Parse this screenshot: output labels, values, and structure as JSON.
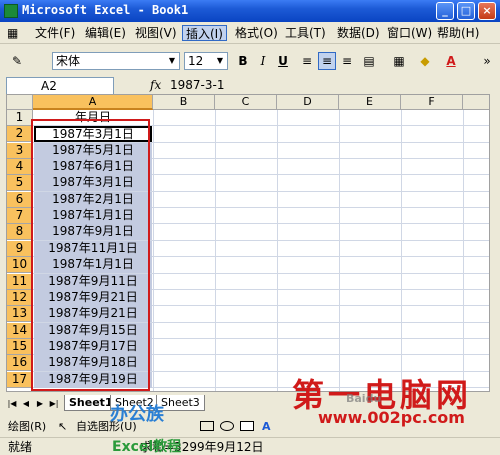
{
  "window": {
    "title": "Microsoft Excel - Book1",
    "minimize": "_",
    "maximize": "□",
    "close": "×"
  },
  "menubar": {
    "items": [
      "文件(F)",
      "编辑(E)",
      "视图(V)",
      "插入(I)",
      "格式(O)",
      "工具(T)",
      "数据(D)",
      "窗口(W)",
      "帮助(H)"
    ],
    "active_index": 3
  },
  "toolbar": {
    "font_name": "宋体",
    "font_size": "12",
    "bold": "B",
    "italic": "I",
    "underline": "U",
    "font_color_label": "A"
  },
  "formula_bar": {
    "name_box": "A2",
    "fx": "fx",
    "value": "1987-3-1"
  },
  "sheet": {
    "columns": [
      "A",
      "B",
      "C",
      "D",
      "E",
      "F"
    ],
    "rows": [
      "1",
      "2",
      "3",
      "4",
      "5",
      "6",
      "7",
      "8",
      "9",
      "10",
      "11",
      "12",
      "13",
      "14",
      "15",
      "16",
      "17"
    ],
    "cells_A": [
      "年月日",
      "1987年3月1日",
      "1987年5月1日",
      "1987年6月1日",
      "1987年3月1日",
      "1987年2月1日",
      "1987年1月1日",
      "1987年9月1日",
      "1987年11月1日",
      "1987年1月1日",
      "1987年9月11日",
      "1987年9月21日",
      "1987年9月21日",
      "1987年9月15日",
      "1987年9月17日",
      "1987年9月18日",
      "1987年9月19日"
    ]
  },
  "tabs": {
    "sheet1": "Sheet1",
    "sheet2": "Sheet2",
    "sheet3": "Sheet3"
  },
  "drawbar": {
    "draw_label": "绘图(R)",
    "autoshapes_label": "自选图形(U)"
  },
  "statusbar": {
    "ready": "就绪",
    "sum": "求和=3299年9月12日"
  },
  "watermarks": {
    "site_cn": "第一电脑网",
    "site_url": "www.002pc.com",
    "brand_office": "办公族",
    "brand_excel": "Excel教程",
    "baidu": "Baidu"
  }
}
